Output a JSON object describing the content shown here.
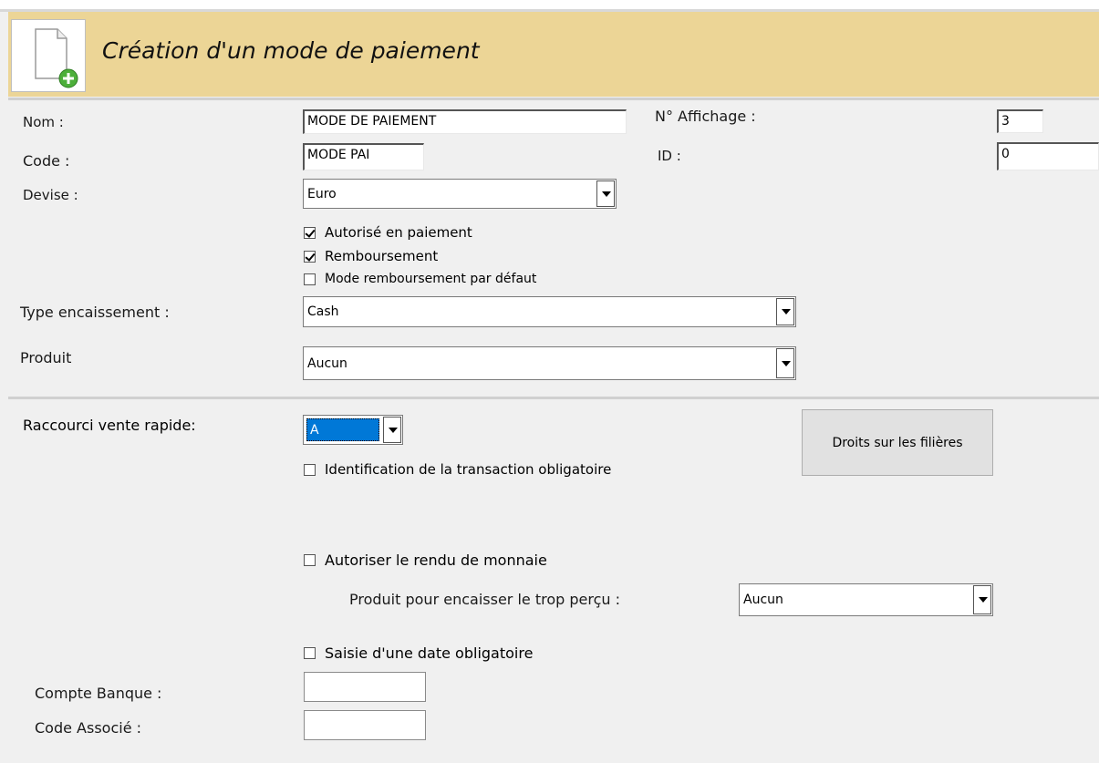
{
  "window": {
    "title": "Création d'un mode de paiement",
    "icon": "new-document-icon",
    "header_color": "#ecd596"
  },
  "form": {
    "nom": {
      "label": "Nom :",
      "value": "MODE DE PAIEMENT"
    },
    "affichage": {
      "label": "N° Affichage :",
      "value": "3"
    },
    "code": {
      "label": "Code :",
      "value": "MODE PAI"
    },
    "id": {
      "label": "ID :",
      "value": "0"
    },
    "devise": {
      "label": "Devise :",
      "value": "Euro"
    },
    "checkboxes": [
      {
        "label": "Autorisé en paiement",
        "checked": true
      },
      {
        "label": "Remboursement",
        "checked": true
      },
      {
        "label": "Mode remboursement par défaut",
        "checked": false
      }
    ],
    "type_encaissement": {
      "label": "Type encaissement :",
      "value": "Cash"
    },
    "produit": {
      "label": "Produit",
      "value": "Aucun"
    }
  },
  "options": {
    "raccourci": {
      "label": "Raccourci vente rapide:",
      "value": "A"
    },
    "droits_button": "Droits sur les filières",
    "identification": {
      "label": "Identification de la transaction obligatoire",
      "checked": false
    },
    "rendu_monnaie": {
      "label": "Autoriser le rendu de monnaie",
      "checked": false
    },
    "produit_trop_percu": {
      "label": "Produit pour encaisser le trop perçu :",
      "value": "Aucun"
    },
    "saisie_date": {
      "label": "Saisie d'une date obligatoire",
      "checked": false
    },
    "compte_banque": {
      "label": "Compte Banque :",
      "value": ""
    },
    "code_associe": {
      "label": "Code Associé :",
      "value": ""
    }
  },
  "colors": {
    "selection": "#0078d7",
    "header": "#ecd596"
  }
}
